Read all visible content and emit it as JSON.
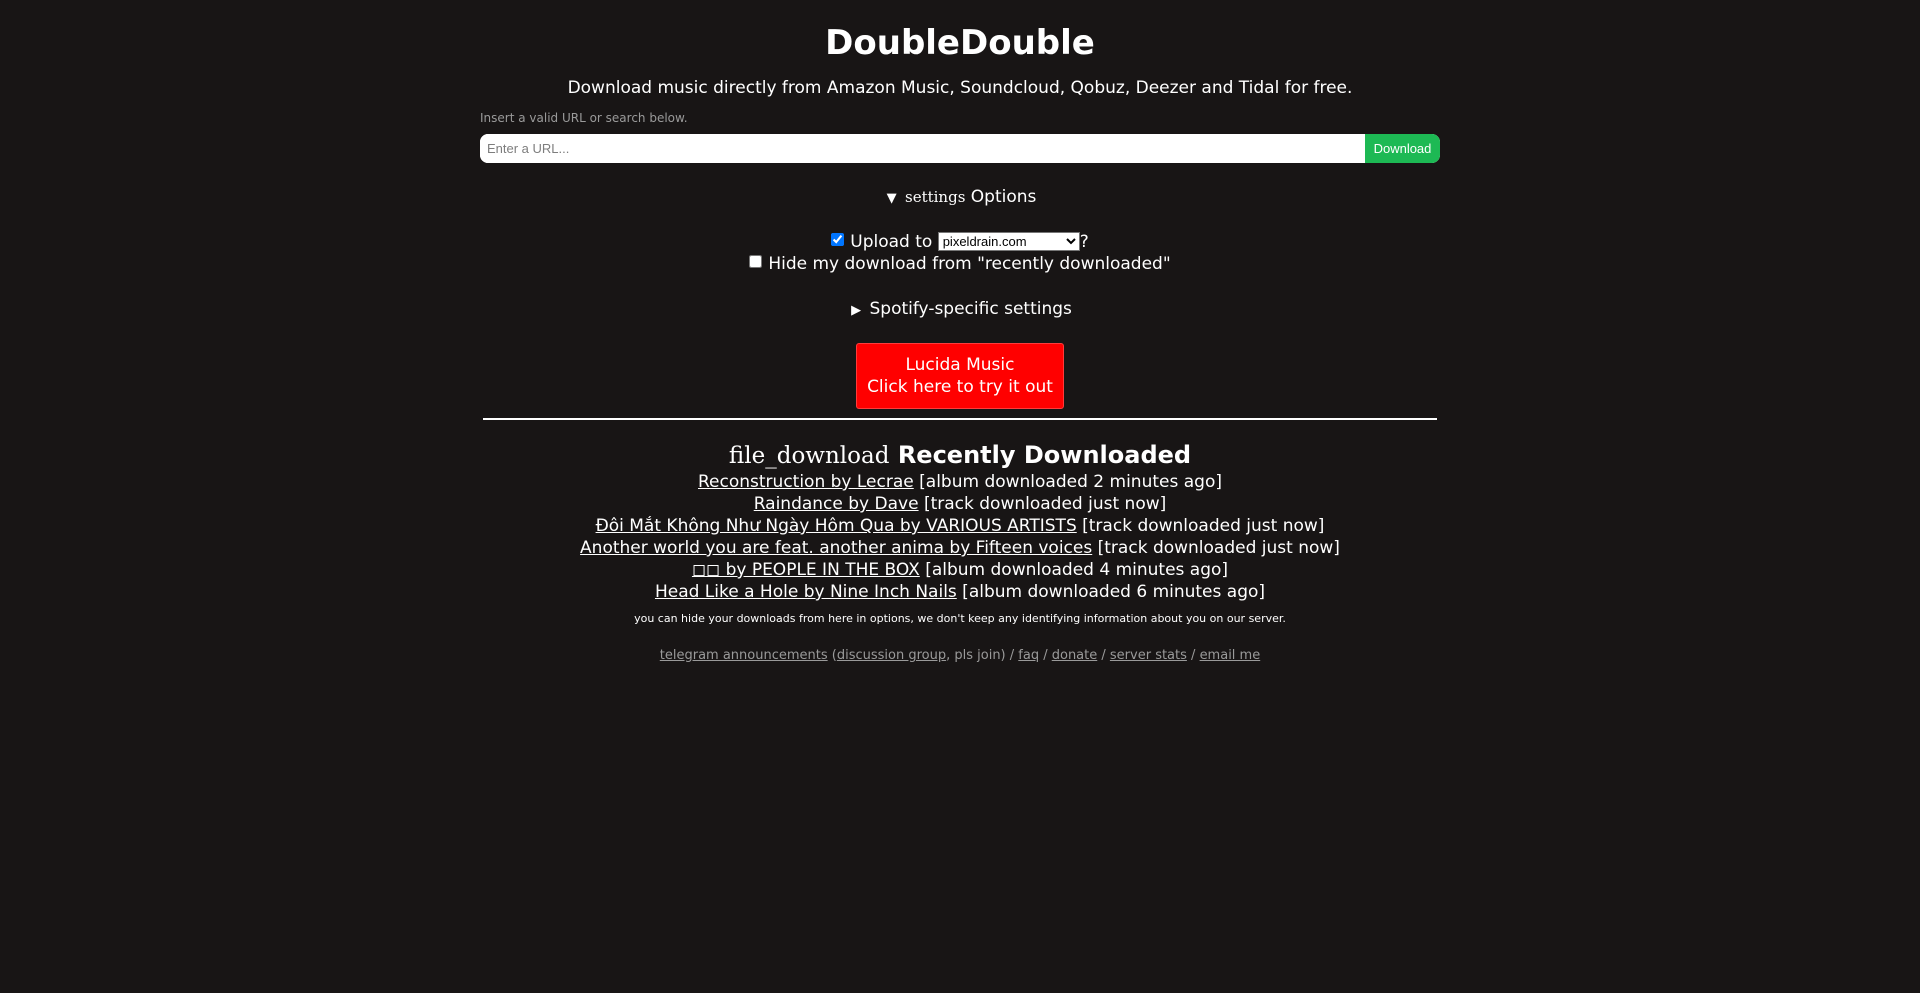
{
  "header": {
    "title": "DoubleDouble",
    "tagline": "Download music directly from Amazon Music, Soundcloud, Qobuz, Deezer and Tidal for free."
  },
  "search": {
    "hint": "Insert a valid URL or search below.",
    "placeholder": "Enter a URL...",
    "button_label": "Download"
  },
  "options": {
    "icon": "settings",
    "label": "Options",
    "upload_prefix": "Upload to",
    "upload_checked": true,
    "host_selected": "pixeldrain.com",
    "upload_suffix": "?",
    "hide_label": "Hide my download from \"recently downloaded\"",
    "hide_checked": false,
    "spotify_label": "Spotify-specific settings"
  },
  "promo": {
    "line1": "Lucida Music",
    "line2": "Click here to try it out"
  },
  "recent": {
    "icon": "file_download",
    "title": "Recently Downloaded",
    "items": [
      {
        "link": "Reconstruction by Lecrae",
        "info": " [album downloaded 2 minutes ago]"
      },
      {
        "link": "Raindance by Dave",
        "info": " [track downloaded just now]"
      },
      {
        "link": "Đôi Mắt Không Như Ngày Hôm Qua by VARIOUS ARTISTS",
        "info": " [track downloaded just now]"
      },
      {
        "link": "Another world you are feat. another anima by Fifteen voices",
        "info": " [track downloaded just now]"
      },
      {
        "link": "◻◻ by PEOPLE IN THE BOX",
        "info": " [album downloaded 4 minutes ago]"
      },
      {
        "link": "Head Like a Hole by Nine Inch Nails",
        "info": " [album downloaded 6 minutes ago]"
      }
    ],
    "note": "you can hide your downloads from here in options, we don't keep any identifying information about you on our server."
  },
  "footer": {
    "telegram": "telegram announcements",
    "open_paren": " (",
    "discussion": "discussion group",
    "pls_join": ", pls join) / ",
    "faq": "faq",
    "sep1": " / ",
    "donate": "donate",
    "sep2": " / ",
    "stats": "server stats",
    "sep3": " / ",
    "email": "email me"
  }
}
